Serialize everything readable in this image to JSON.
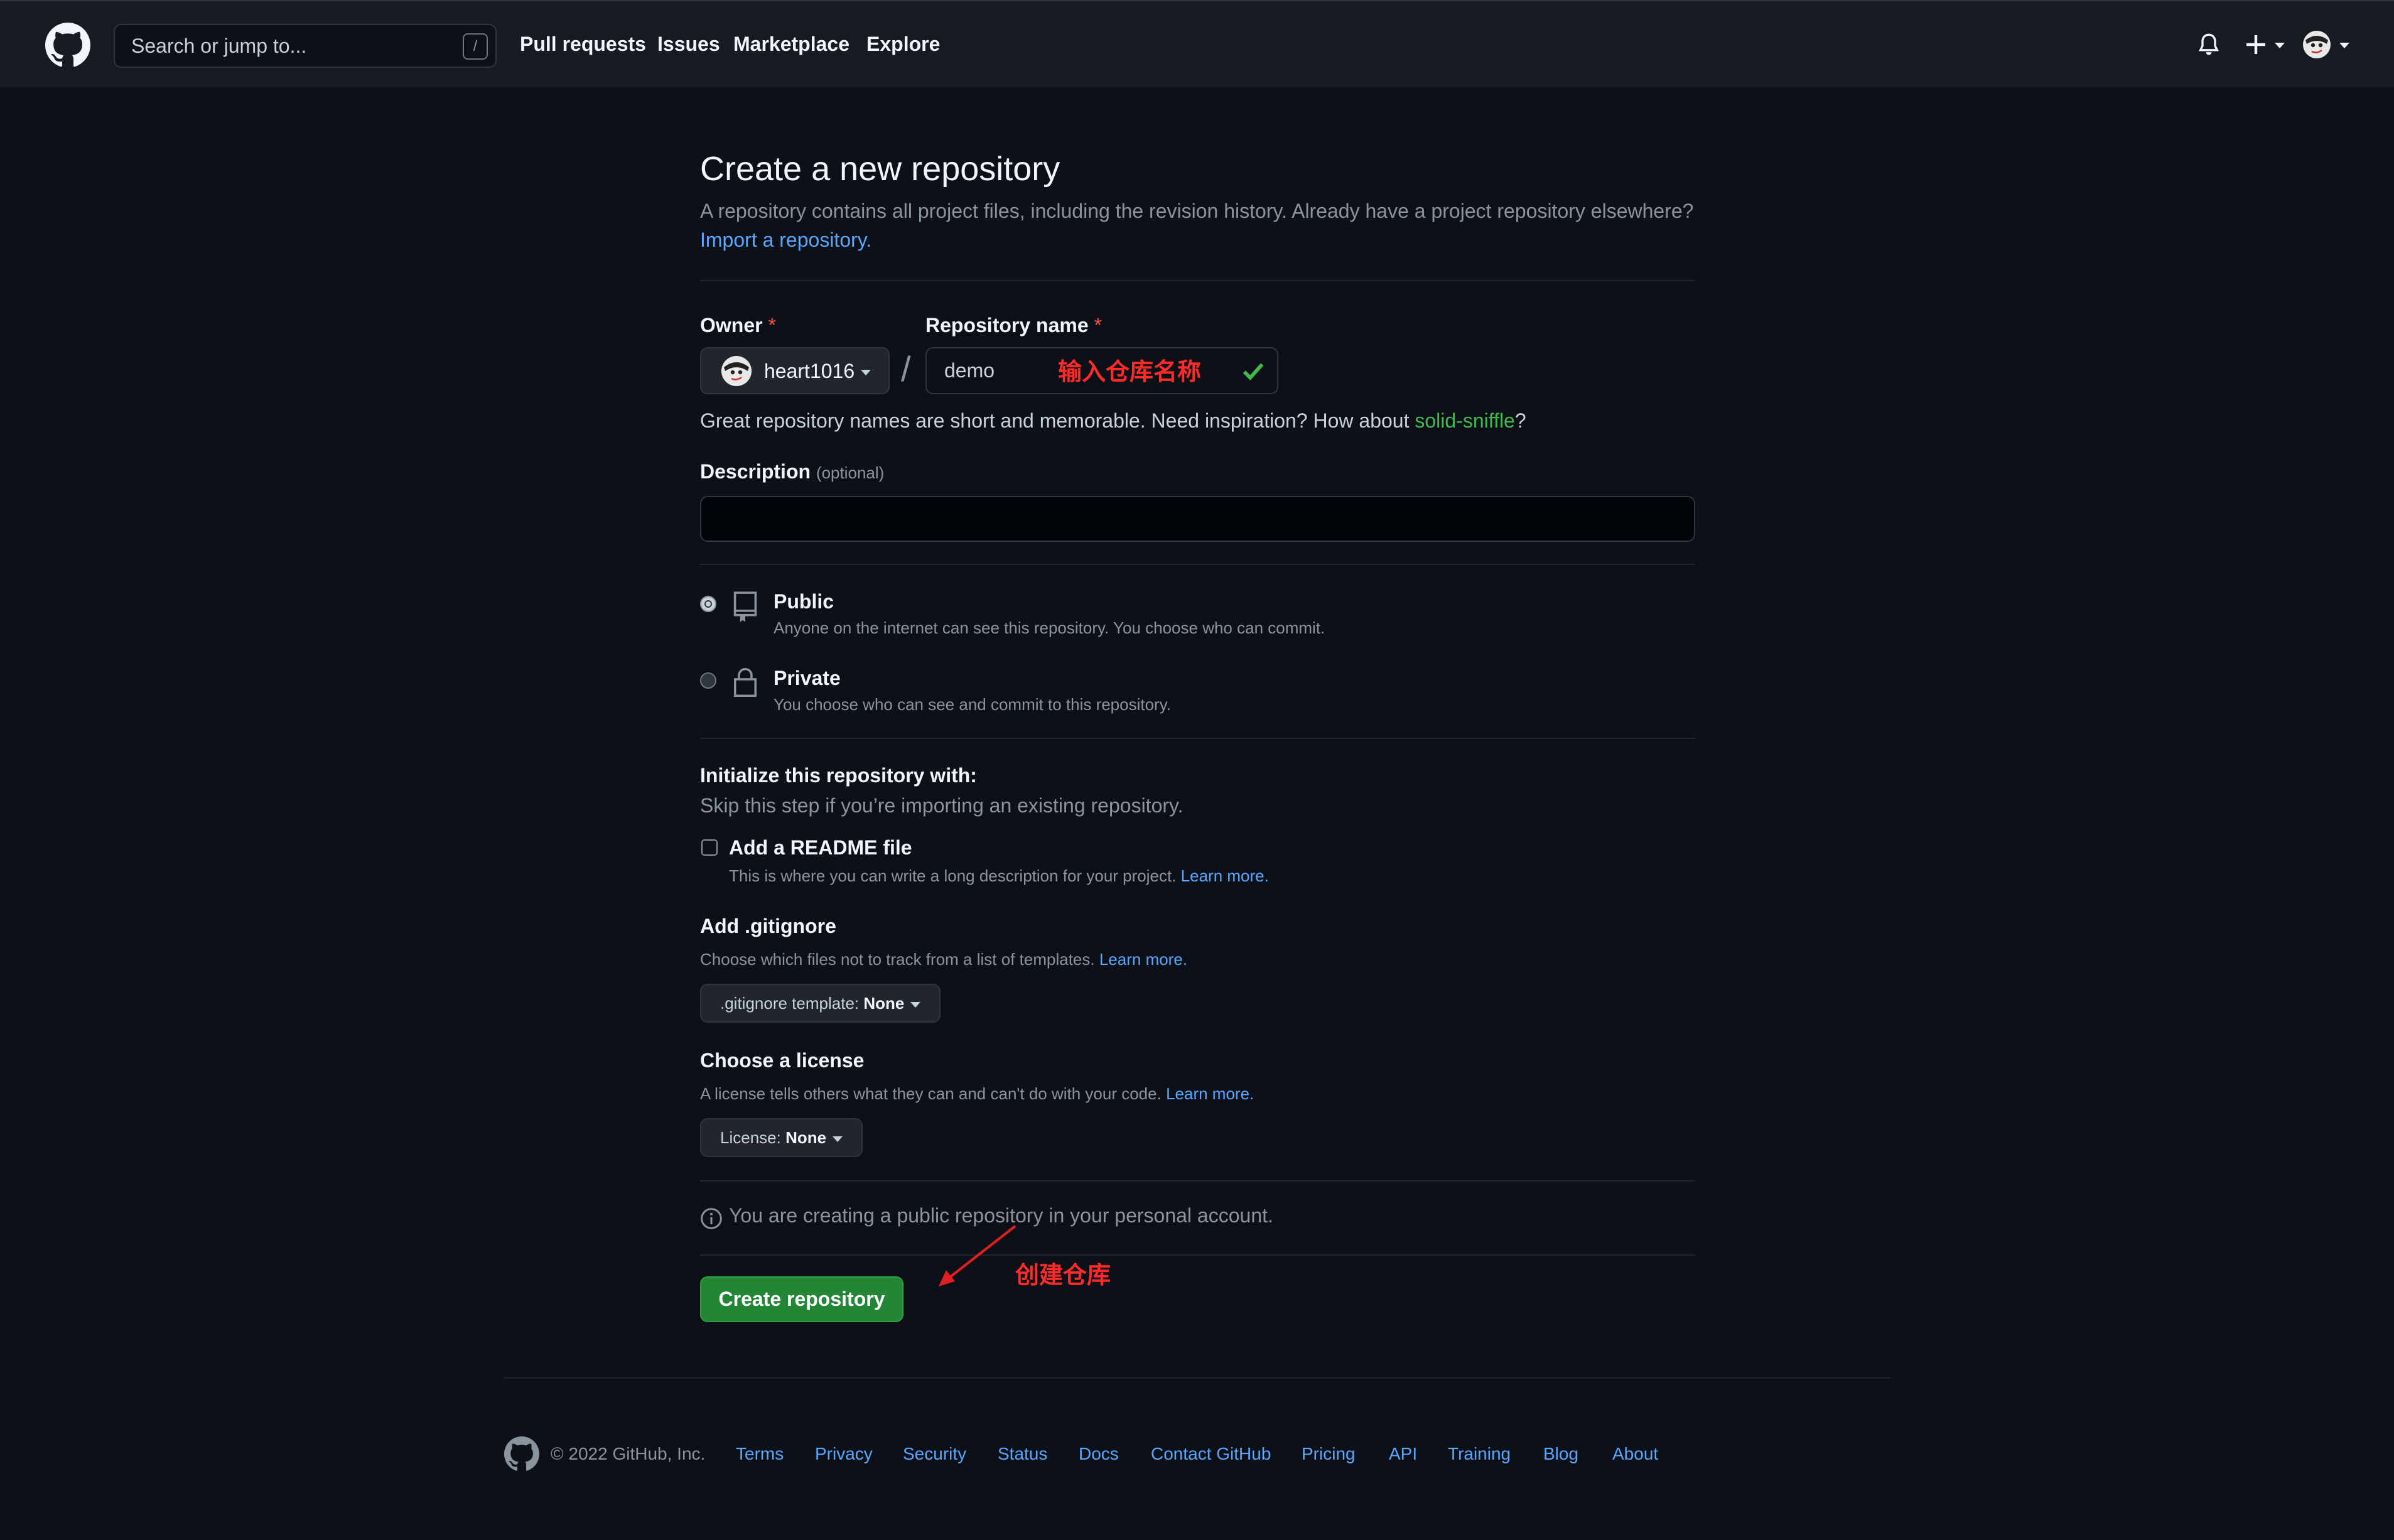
{
  "header": {
    "search_placeholder": "Search or jump to...",
    "search_shortcut": "/",
    "nav": [
      "Pull requests",
      "Issues",
      "Marketplace",
      "Explore"
    ]
  },
  "page": {
    "title": "Create a new repository",
    "subtitle": "A repository contains all project files, including the revision history. Already have a project repository elsewhere?",
    "import_link": "Import a repository."
  },
  "form": {
    "owner_label": "Owner",
    "required_mark": "*",
    "owner_value": "heart1016",
    "repo_label": "Repository name",
    "repo_value": "demo",
    "name_hint": "Great repository names are short and memorable. Need inspiration? How about ",
    "name_suggestion": "solid-sniffle",
    "name_hint_end": "?",
    "description_label": "Description",
    "description_optional": "(optional)",
    "description_value": "",
    "visibility": [
      {
        "title": "Public",
        "desc": "Anyone on the internet can see this repository. You choose who can commit.",
        "selected": true
      },
      {
        "title": "Private",
        "desc": "You choose who can see and commit to this repository.",
        "selected": false
      }
    ],
    "init_title": "Initialize this repository with:",
    "init_sub": "Skip this step if you’re importing an existing repository.",
    "readme_label": "Add a README file",
    "readme_desc": "This is where you can write a long description for your project.",
    "learn_more": "Learn more.",
    "gitignore_title": "Add .gitignore",
    "gitignore_desc": "Choose which files not to track from a list of templates.",
    "gitignore_select_prefix": ".gitignore template:",
    "gitignore_select_value": "None",
    "license_title": "Choose a license",
    "license_desc": "A license tells others what they can and can't do with your code.",
    "license_select_prefix": "License:",
    "license_select_value": "None",
    "info_text": "You are creating a public repository in your personal account.",
    "create_button": "Create repository"
  },
  "annotations": {
    "repo_name_note": "输入仓库名称",
    "create_note": "创建仓库",
    "color": "#ff2a2a"
  },
  "footer": {
    "copyright": "© 2022 GitHub, Inc.",
    "links": [
      "Terms",
      "Privacy",
      "Security",
      "Status",
      "Docs",
      "Contact GitHub",
      "Pricing",
      "API",
      "Training",
      "Blog",
      "About"
    ]
  },
  "colors": {
    "background": "#0d1117",
    "header": "#161b22",
    "link": "#58a6ff",
    "primary_button": "#238636",
    "success": "#3fb950",
    "required": "#f85149"
  }
}
